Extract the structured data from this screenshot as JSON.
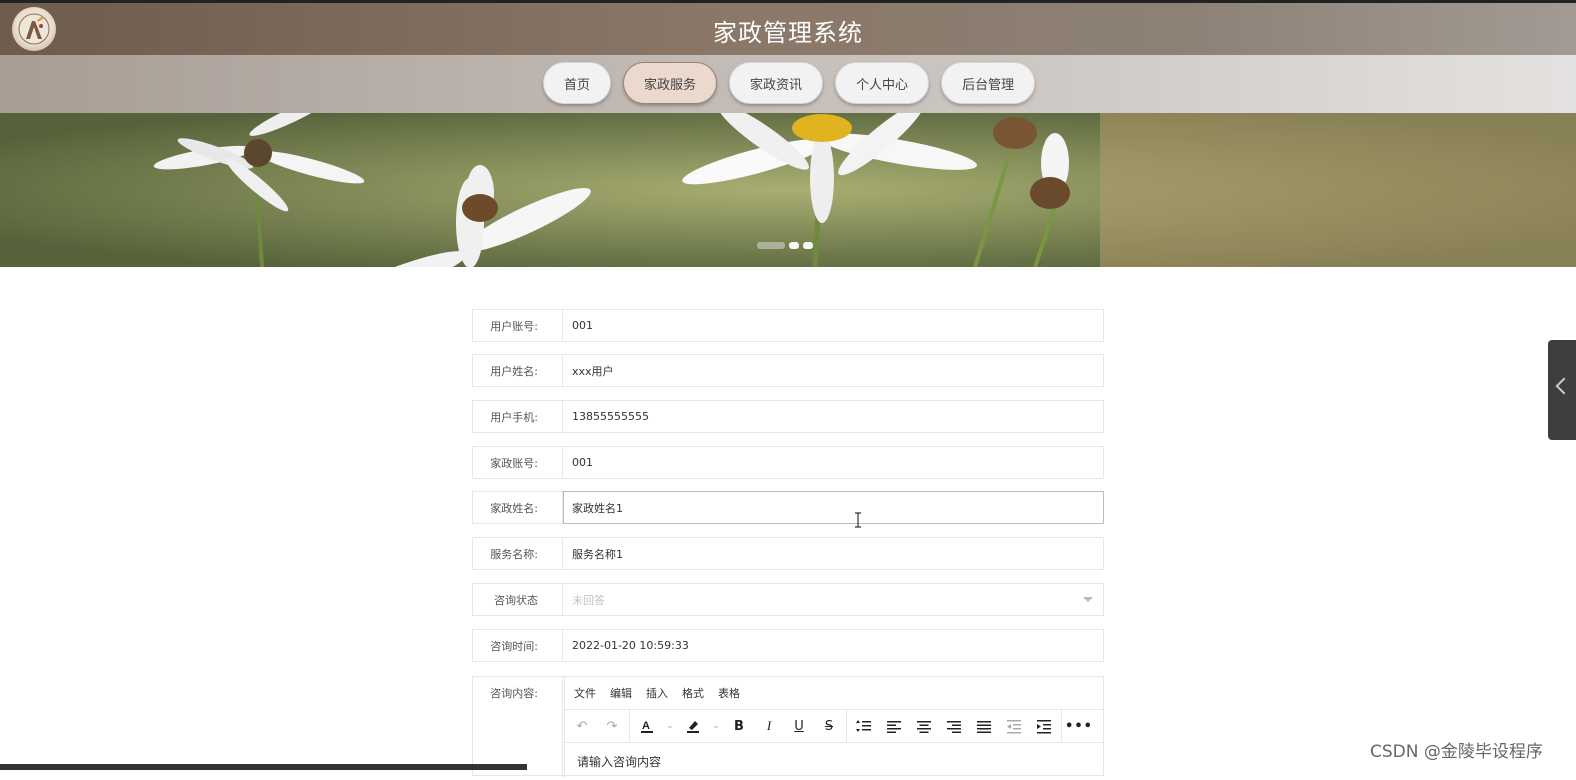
{
  "header": {
    "title": "家政管理系统",
    "logo_icon": "logo-badge-icon"
  },
  "nav": {
    "items": [
      {
        "label": "首页",
        "active": false
      },
      {
        "label": "家政服务",
        "active": true
      },
      {
        "label": "家政资讯",
        "active": false
      },
      {
        "label": "个人中心",
        "active": false
      },
      {
        "label": "后台管理",
        "active": false
      }
    ]
  },
  "banner": {
    "slides_count": 3,
    "active_slide": 1
  },
  "form": {
    "fields": [
      {
        "label": "用户账号:",
        "value": "001"
      },
      {
        "label": "用户姓名:",
        "value": "xxx用户"
      },
      {
        "label": "用户手机:",
        "value": "13855555555"
      },
      {
        "label": "家政账号:",
        "value": "001"
      },
      {
        "label": "家政姓名:",
        "value": "家政姓名1"
      },
      {
        "label": "服务名称:",
        "value": "服务名称1"
      },
      {
        "label": "咨询状态",
        "placeholder": "未回答"
      },
      {
        "label": "咨询时间:",
        "value": "2022-01-20 10:59:33"
      }
    ],
    "editor": {
      "label": "咨询内容:",
      "menu": [
        "文件",
        "编辑",
        "插入",
        "格式",
        "表格"
      ],
      "placeholder": "请输入咨询内容"
    }
  },
  "watermark": "CSDN @金陵毕设程序",
  "colors": {
    "header_bg": "#7a6757",
    "nav_active": "#ead9cc",
    "side_tab": "#3e3e3e"
  }
}
